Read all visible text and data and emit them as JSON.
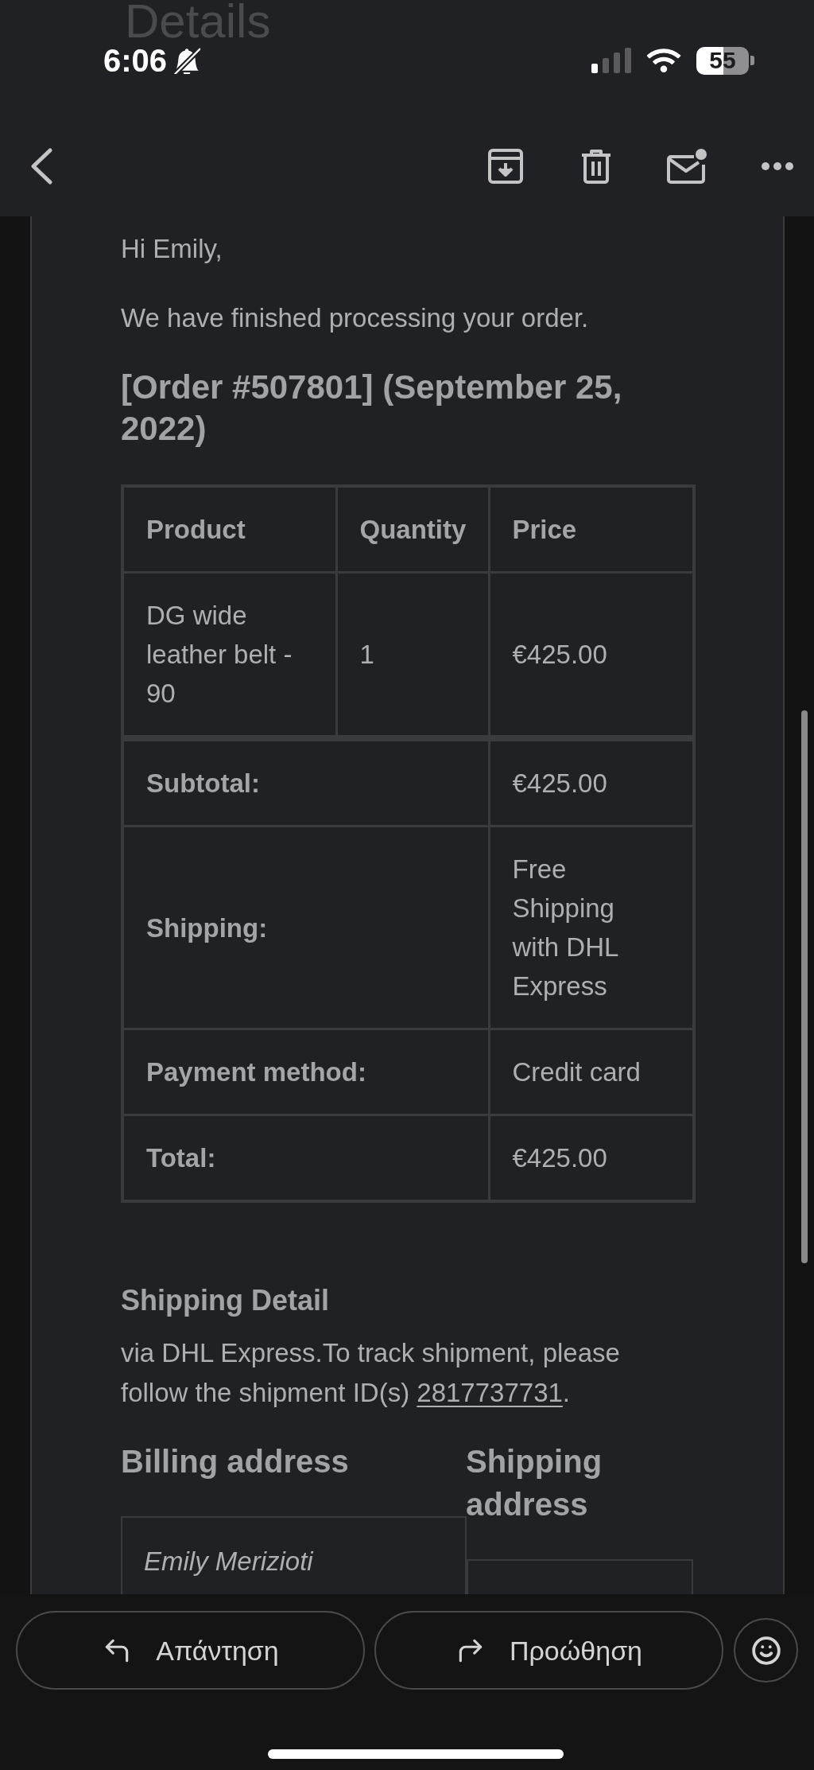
{
  "status_bar": {
    "time": "6:06",
    "battery": "55"
  },
  "large_title": "Details",
  "email": {
    "greeting": "Hi Emily,",
    "intro": "We have finished processing your order.",
    "order_heading": "[Order #507801] (September 25, 2022)",
    "order_table": {
      "columns": [
        "Product",
        "Quantity",
        "Price"
      ],
      "rows": [
        {
          "product": "DG wide leather belt - 90",
          "quantity": "1",
          "price": "€425.00"
        }
      ],
      "totals": [
        {
          "label": "Subtotal:",
          "value": "€425.00"
        },
        {
          "label": "Shipping:",
          "value": "Free Shipping with DHL Express"
        },
        {
          "label": "Payment method:",
          "value": "Credit card"
        },
        {
          "label": "Total:",
          "value": "€425.00"
        }
      ]
    },
    "shipping_detail": {
      "heading": "Shipping Detail",
      "text": "via DHL Express.To track shipment, please follow the shipment ID(s)",
      "tracking_id": "2817737731",
      "text_end": "."
    },
    "addresses": {
      "billing": {
        "heading": "Billing address",
        "lines": [
          "Emily Merizioti"
        ]
      },
      "shipping": {
        "heading": "Shipping address"
      }
    }
  },
  "actions": [
    {
      "kind": "reply",
      "label": "Απάντηση"
    },
    {
      "kind": "forward",
      "label": "Προώθηση"
    }
  ]
}
